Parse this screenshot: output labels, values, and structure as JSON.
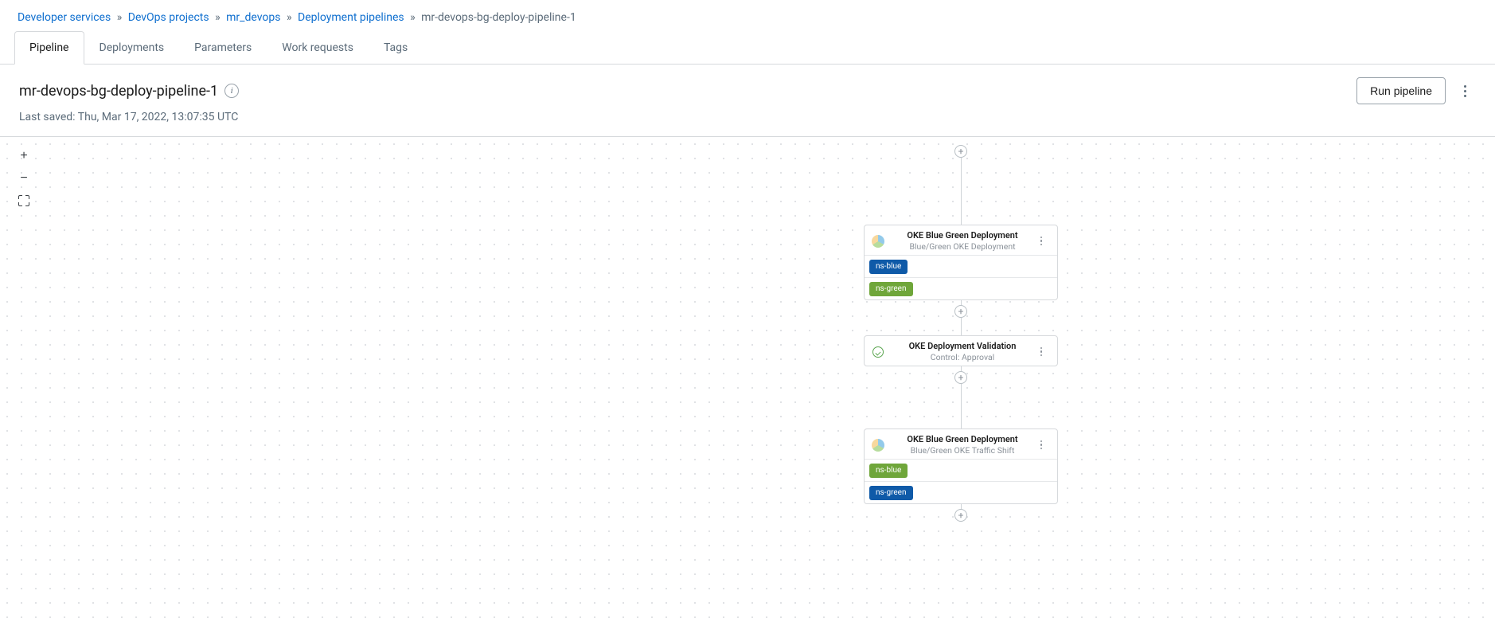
{
  "breadcrumb": {
    "items": [
      {
        "label": "Developer services"
      },
      {
        "label": "DevOps projects"
      },
      {
        "label": "mr_devops"
      },
      {
        "label": "Deployment pipelines"
      }
    ],
    "current": "mr-devops-bg-deploy-pipeline-1"
  },
  "tabs": [
    {
      "label": "Pipeline",
      "active": true
    },
    {
      "label": "Deployments"
    },
    {
      "label": "Parameters"
    },
    {
      "label": "Work requests"
    },
    {
      "label": "Tags"
    }
  ],
  "header": {
    "title": "mr-devops-bg-deploy-pipeline-1",
    "saved": "Last saved: Thu, Mar 17, 2022, 13:07:35 UTC",
    "run_label": "Run pipeline"
  },
  "stages": [
    {
      "title": "OKE Blue Green Deployment",
      "subtitle": "Blue/Green OKE Deployment",
      "icon": "kube",
      "tags": [
        {
          "label": "ns-blue",
          "style": "blue"
        },
        {
          "label": "ns-green",
          "style": "green"
        }
      ]
    },
    {
      "title": "OKE Deployment Validation",
      "subtitle": "Control: Approval",
      "icon": "approval",
      "tags": []
    },
    {
      "title": "OKE Blue Green Deployment",
      "subtitle": "Blue/Green OKE Traffic Shift",
      "icon": "kube",
      "tags": [
        {
          "label": "ns-blue",
          "style": "green"
        },
        {
          "label": "ns-green",
          "style": "blue"
        }
      ]
    }
  ]
}
